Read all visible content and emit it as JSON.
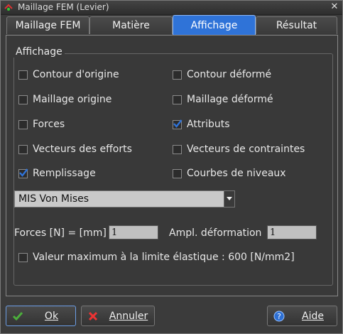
{
  "window": {
    "title": "Maillage FEM (Levier)"
  },
  "tabs": [
    {
      "label": "Maillage FEM"
    },
    {
      "label": "Matière"
    },
    {
      "label": "Affichage"
    },
    {
      "label": "Résultat"
    }
  ],
  "group": {
    "label": "Affichage"
  },
  "checkboxes": {
    "contour_origine": {
      "label": "Contour d'origine",
      "checked": false
    },
    "contour_deforme": {
      "label": "Contour déformé",
      "checked": false
    },
    "maillage_origine": {
      "label": "Maillage origine",
      "checked": false
    },
    "maillage_deforme": {
      "label": "Maillage déformé",
      "checked": false
    },
    "forces": {
      "label": "Forces",
      "checked": false
    },
    "attributs": {
      "label": "Attributs",
      "checked": true
    },
    "vecteurs_efforts": {
      "label": "Vecteurs des efforts",
      "checked": false
    },
    "vecteurs_contraintes": {
      "label": "Vecteurs de contraintes",
      "checked": false
    },
    "remplissage": {
      "label": "Remplissage",
      "checked": true
    },
    "courbes_niveaux": {
      "label": "Courbes de niveaux",
      "checked": false
    },
    "valeur_max": {
      "label": "Valeur maximum à la limite élastique : 600 [N/mm2]",
      "checked": false
    }
  },
  "result_select": {
    "value": "MIS Von Mises"
  },
  "forces_field": {
    "label": "Forces [N] = [mm]",
    "value": "1"
  },
  "ampl_field": {
    "label": "Ampl. déformation",
    "value": "1"
  },
  "buttons": {
    "ok": "Ok",
    "cancel": "Annuler",
    "help": "Aide"
  },
  "colors": {
    "accent": "#2f73d8",
    "check": "#2f73d8"
  }
}
